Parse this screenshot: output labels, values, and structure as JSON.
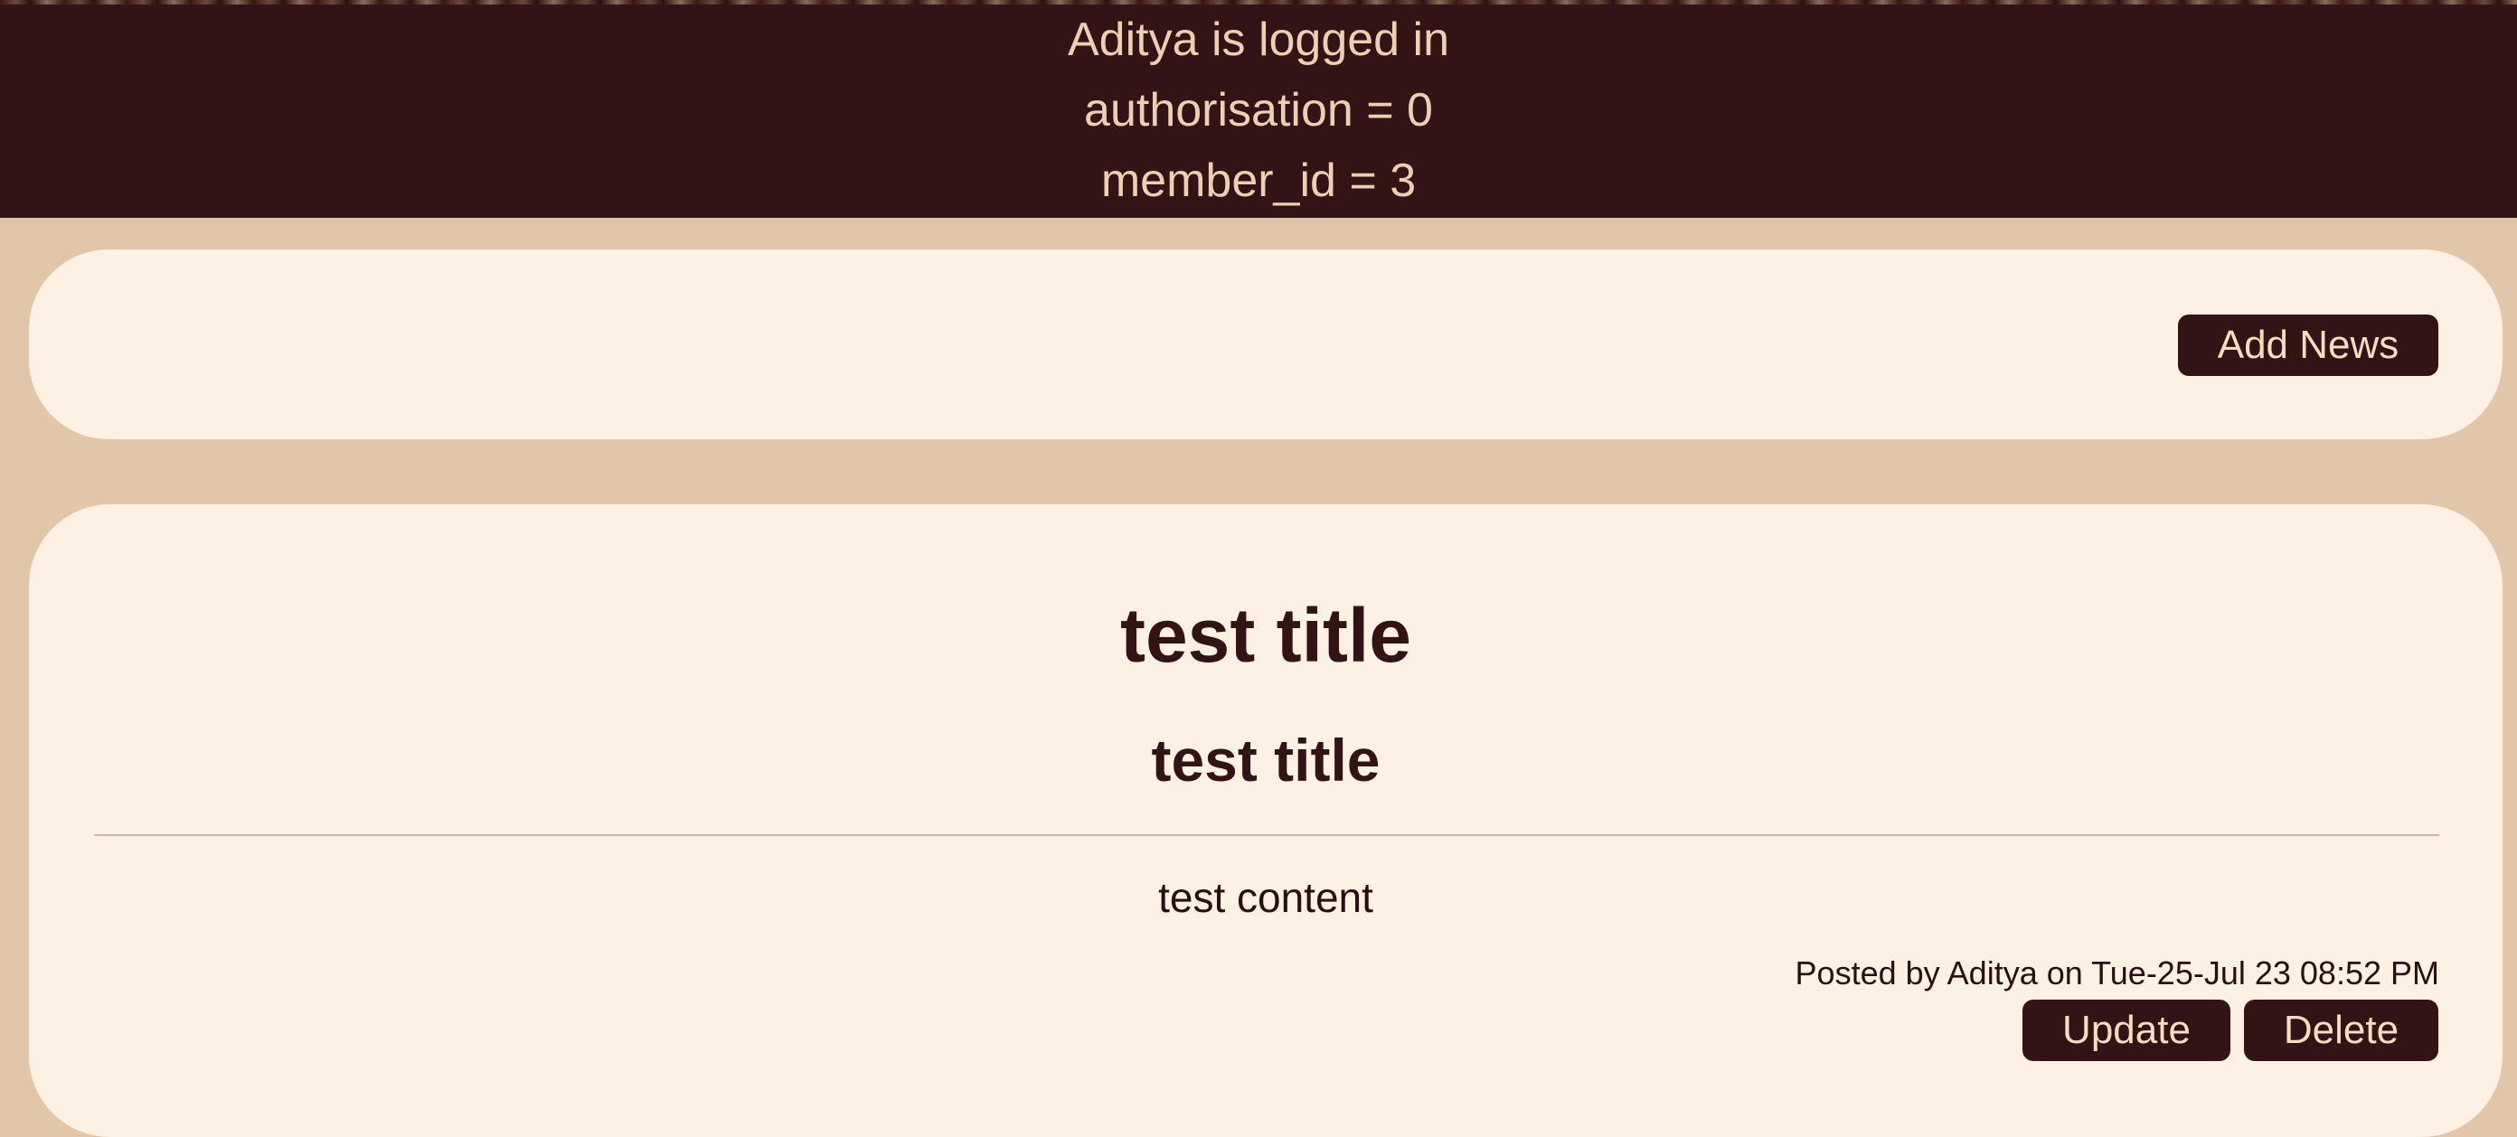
{
  "status": {
    "logged_in_line": "Aditya is logged in",
    "authorisation_line": "authorisation = 0",
    "member_id_line": "member_id = 3"
  },
  "toolbar": {
    "add_news_label": "Add News"
  },
  "news_item": {
    "title": "test title",
    "subtitle": "test title",
    "content": "test content",
    "meta": "Posted by Aditya on Tue-25-Jul 23 08:52 PM",
    "update_label": "Update",
    "delete_label": "Delete"
  },
  "colors": {
    "header_bg": "#331414",
    "page_bg": "#e2c6a9",
    "panel_bg": "#fdf1e3",
    "button_bg": "#331414",
    "header_text": "#edcfb1"
  }
}
